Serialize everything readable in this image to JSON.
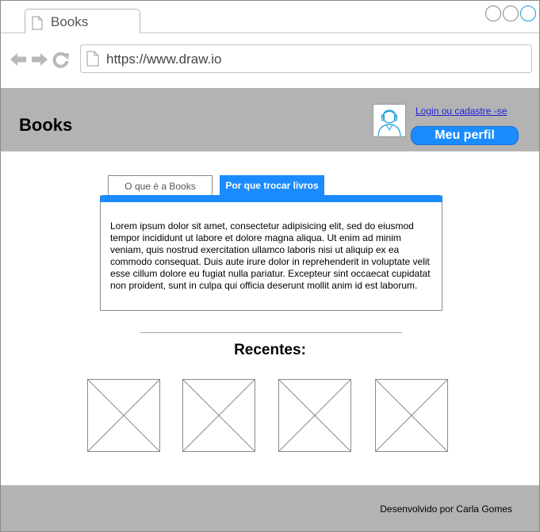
{
  "browser": {
    "tab_title": "Books",
    "url": "https://www.draw.io"
  },
  "header": {
    "title": "Books",
    "login_link": "Login ou cadastre -se",
    "profile_button": "Meu perfil"
  },
  "tabs": [
    {
      "label": "O que é a Books",
      "active": false
    },
    {
      "label": "Por que trocar livros",
      "active": true
    }
  ],
  "panel": {
    "text": "Lorem ipsum dolor sit amet, consectetur adipisicing elit, sed do eiusmod tempor incididunt ut labore et dolore magna aliqua. Ut enim ad minim veniam, quis nostrud exercitation ullamco laboris nisi ut aliquip ex ea commodo consequat. Duis aute irure dolor in reprehenderit in voluptate velit esse cillum dolore eu fugiat nulla pariatur. Excepteur sint occaecat cupidatat non proident, sunt in culpa qui officia deserunt mollit anim id est laborum."
  },
  "recent": {
    "title": "Recentes:"
  },
  "footer": {
    "credit": "Desenvolvido por  Carla Gomes"
  },
  "colors": {
    "accent": "#1a8cff",
    "header_bg": "#b3b3b3",
    "link": "#1e1ed8"
  }
}
